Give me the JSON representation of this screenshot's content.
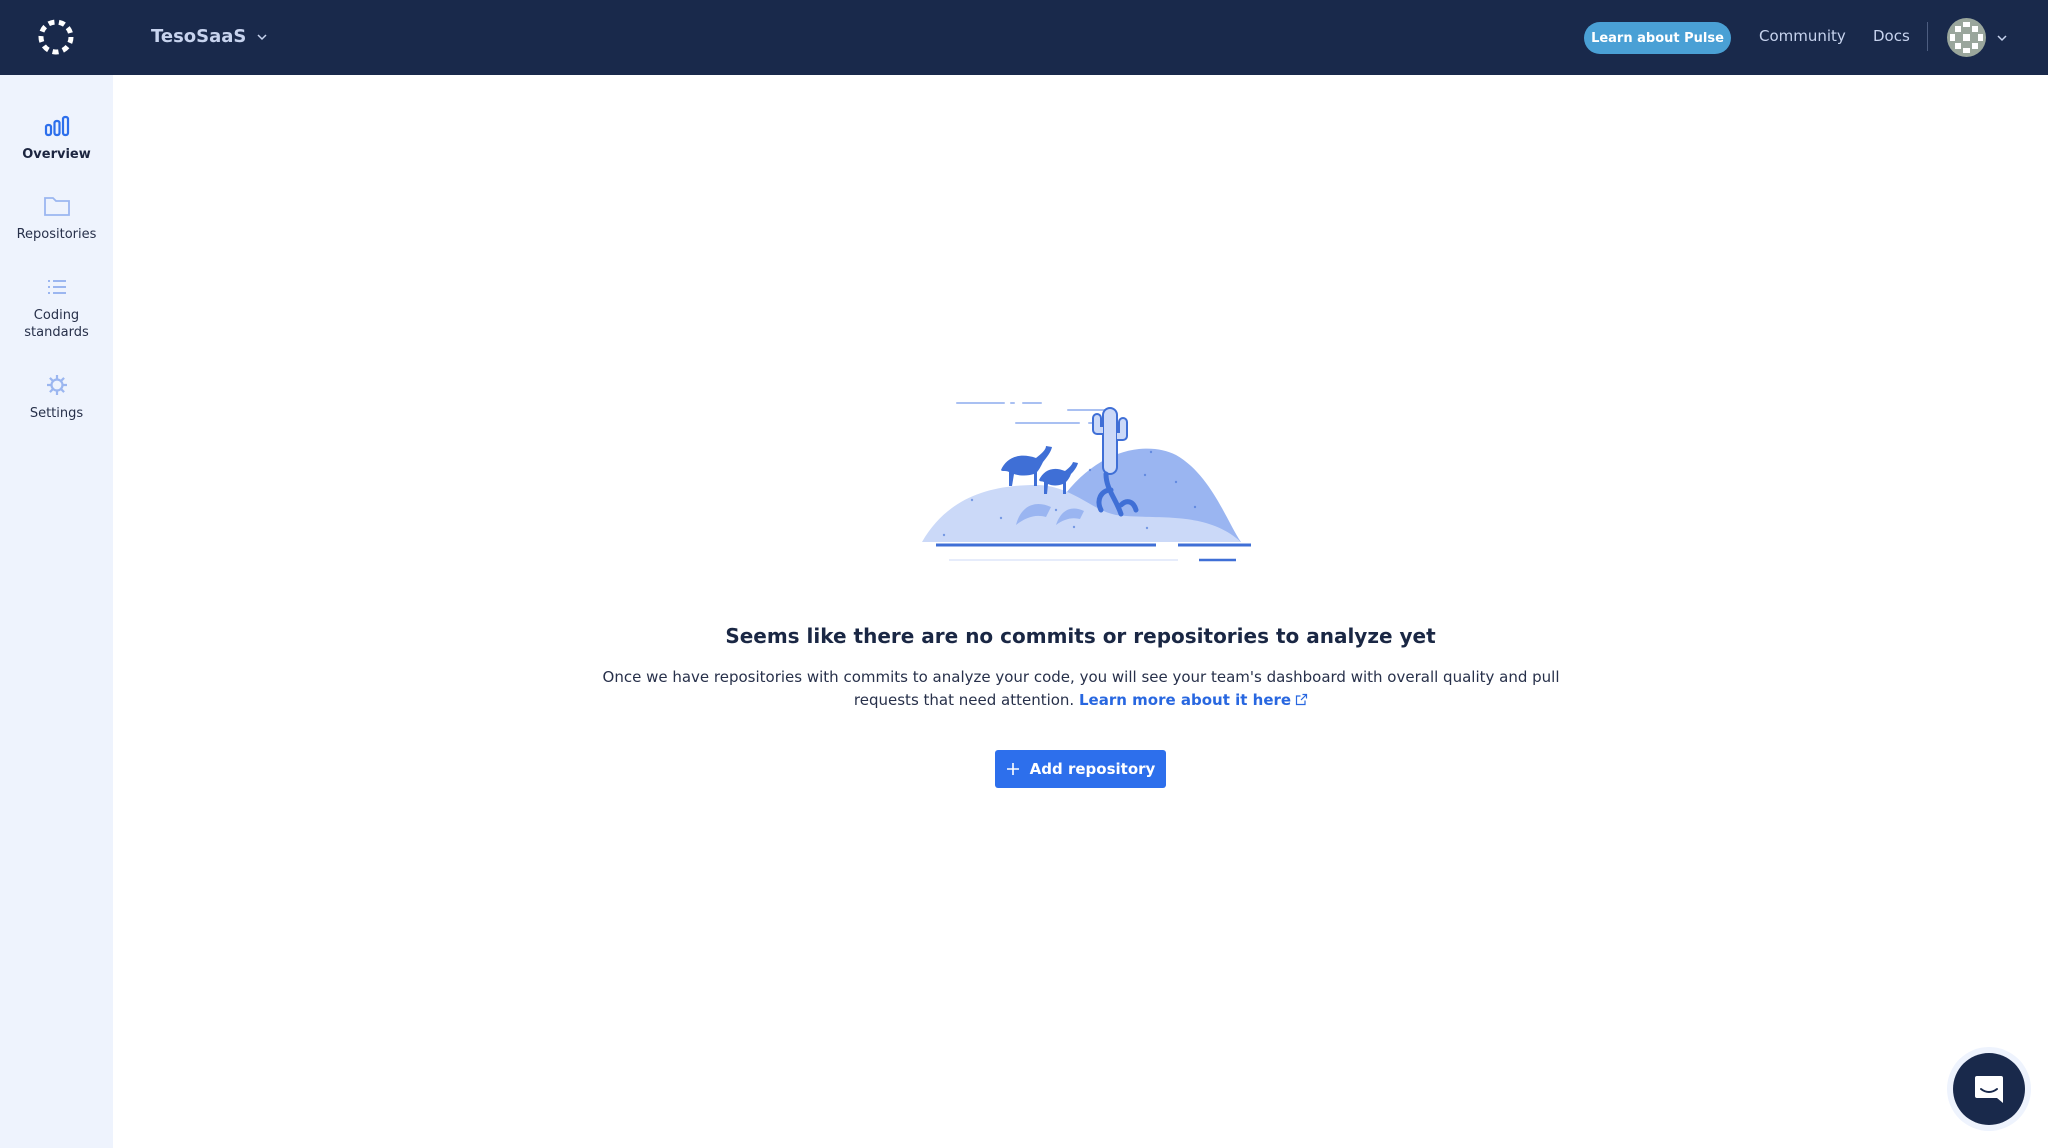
{
  "header": {
    "logo": "spinner-ring-logo",
    "org_name": "TesoSaaS",
    "pulse_button": "Learn about Pulse",
    "links": [
      "Community",
      "Docs"
    ],
    "colors": {
      "bar": "#19294b",
      "pulse": "#4aa0d5"
    }
  },
  "sidebar": {
    "items": [
      {
        "label": "Overview",
        "icon": "bar-chart-icon",
        "active": true
      },
      {
        "label": "Repositories",
        "icon": "folder-icon",
        "active": false
      },
      {
        "label": "Coding standards",
        "icon": "list-icon",
        "active": false
      },
      {
        "label": "Settings",
        "icon": "gear-icon",
        "active": false
      }
    ]
  },
  "empty_state": {
    "illustration": "desert-camels-cactus",
    "title": "Seems like there are no commits or repositories to analyze yet",
    "body": "Once we have repositories with commits to analyze your code, you will see your team's dashboard with overall quality and pull requests that need attention.",
    "link": "Learn more about it here",
    "button": "Add repository",
    "accent": "#2d6fec"
  },
  "chat_widget": {
    "icon": "chat-bubble-icon"
  }
}
